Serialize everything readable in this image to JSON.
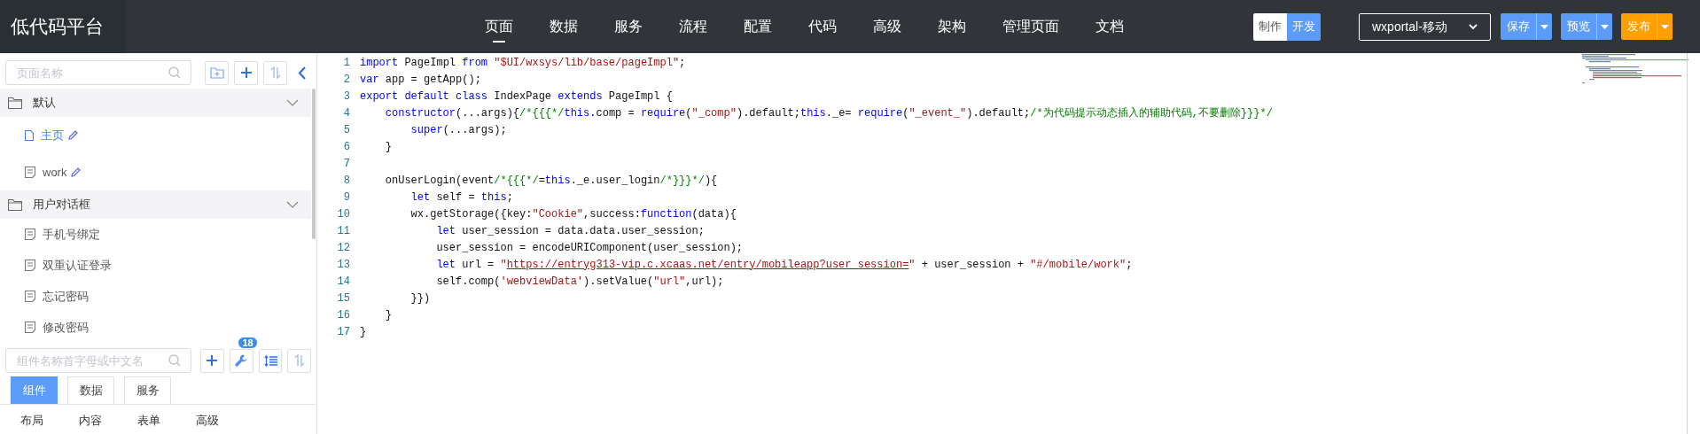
{
  "app_title": "低代码平台",
  "nav": [
    {
      "label": "页面",
      "selected": true
    },
    {
      "label": "数据",
      "selected": false
    },
    {
      "label": "服务",
      "selected": false
    },
    {
      "label": "流程",
      "selected": false
    },
    {
      "label": "配置",
      "selected": false
    },
    {
      "label": "代码",
      "selected": false
    },
    {
      "label": "高级",
      "selected": false
    },
    {
      "label": "架构",
      "selected": false
    },
    {
      "label": "管理页面",
      "selected": false
    },
    {
      "label": "文档",
      "selected": false
    }
  ],
  "mode_toggle": [
    {
      "label": "制作",
      "selected": false
    },
    {
      "label": "开发",
      "selected": true
    }
  ],
  "app_select": {
    "value": "wxportal-移动"
  },
  "actions": [
    {
      "label": "保存",
      "color": "#5b9cf8"
    },
    {
      "label": "预览",
      "color": "#5b9cf8"
    },
    {
      "label": "发布",
      "color": "#ffa000"
    }
  ],
  "page_search": {
    "placeholder": "页面名称"
  },
  "page_tree": [
    {
      "label": "默认",
      "expanded": true,
      "children": [
        {
          "label": "主页",
          "selected": true,
          "editable": true
        },
        {
          "label": "work",
          "selected": false,
          "editable": true
        }
      ]
    },
    {
      "label": "用户对话框",
      "expanded": true,
      "children": [
        {
          "label": "手机号绑定",
          "selected": false,
          "editable": false
        },
        {
          "label": "双重认证登录",
          "selected": false,
          "editable": false
        },
        {
          "label": "忘记密码",
          "selected": false,
          "editable": false
        },
        {
          "label": "修改密码",
          "selected": false,
          "editable": false
        }
      ]
    }
  ],
  "component_search": {
    "placeholder": "组件名称首字母或中文名"
  },
  "tool_badge": "18",
  "panel_tabs": [
    {
      "label": "组件",
      "selected": true
    },
    {
      "label": "数据",
      "selected": false
    },
    {
      "label": "服务",
      "selected": false
    }
  ],
  "categories": [
    "布局",
    "内容",
    "表单",
    "高级"
  ],
  "editor": {
    "lines": [
      {
        "number": "1",
        "tokens": [
          {
            "kind": "keyword",
            "text": "import"
          },
          {
            "kind": "plain",
            "text": " PageImpl "
          },
          {
            "kind": "keyword",
            "text": "from"
          },
          {
            "kind": "string",
            "text": " \"$UI/wxsys/lib/base/pageImpl\""
          },
          {
            "kind": "plain",
            "text": ";"
          }
        ]
      },
      {
        "number": "2",
        "tokens": [
          {
            "kind": "keyword",
            "text": "var"
          },
          {
            "kind": "plain",
            "text": " app = getApp();"
          }
        ]
      },
      {
        "number": "3",
        "tokens": [
          {
            "kind": "keyword",
            "text": "export default class"
          },
          {
            "kind": "plain",
            "text": " IndexPage "
          },
          {
            "kind": "keyword",
            "text": "extends"
          },
          {
            "kind": "plain",
            "text": " PageImpl {"
          }
        ]
      },
      {
        "number": "4",
        "tokens": [
          {
            "kind": "keyword",
            "text": "    constructor"
          },
          {
            "kind": "plain",
            "text": "(...args){"
          },
          {
            "kind": "comment",
            "text": "/*{{{*/"
          },
          {
            "kind": "keyword",
            "text": "this"
          },
          {
            "kind": "plain",
            "text": ".comp = "
          },
          {
            "kind": "keyword",
            "text": "require"
          },
          {
            "kind": "plain",
            "text": "("
          },
          {
            "kind": "string",
            "text": "\"_comp\""
          },
          {
            "kind": "plain",
            "text": ").default;"
          },
          {
            "kind": "keyword",
            "text": "this"
          },
          {
            "kind": "plain",
            "text": "._e= "
          },
          {
            "kind": "keyword",
            "text": "require"
          },
          {
            "kind": "plain",
            "text": "("
          },
          {
            "kind": "string",
            "text": "\"_event_\""
          },
          {
            "kind": "plain",
            "text": ").default;"
          },
          {
            "kind": "comment",
            "text": "/*为代码提示动态插入的辅助代码,不要删除}}}*/"
          }
        ]
      },
      {
        "number": "5",
        "tokens": [
          {
            "kind": "keyword",
            "text": "        super"
          },
          {
            "kind": "plain",
            "text": "(...args);"
          }
        ]
      },
      {
        "number": "6",
        "tokens": [
          {
            "kind": "plain",
            "text": "    }"
          }
        ]
      },
      {
        "number": "7"
      },
      {
        "number": "8",
        "tokens": [
          {
            "kind": "plain",
            "text": "    onUserLogin(event"
          },
          {
            "kind": "comment",
            "text": "/*{{{*/"
          },
          {
            "kind": "plain",
            "text": "="
          },
          {
            "kind": "keyword",
            "text": "this"
          },
          {
            "kind": "plain",
            "text": "._e.user_login"
          },
          {
            "kind": "comment",
            "text": "/*}}}*/"
          },
          {
            "kind": "plain",
            "text": "){"
          }
        ]
      },
      {
        "number": "9",
        "tokens": [
          {
            "kind": "keyword",
            "text": "        let"
          },
          {
            "kind": "plain",
            "text": " self = "
          },
          {
            "kind": "keyword",
            "text": "this"
          },
          {
            "kind": "plain",
            "text": ";"
          }
        ]
      },
      {
        "number": "10",
        "tokens": [
          {
            "kind": "plain",
            "text": "        wx.getStorage({key:"
          },
          {
            "kind": "string",
            "text": "\"Cookie\""
          },
          {
            "kind": "plain",
            "text": ",success:"
          },
          {
            "kind": "keyword",
            "text": "function"
          },
          {
            "kind": "plain",
            "text": "(data){"
          }
        ]
      },
      {
        "number": "11",
        "tokens": [
          {
            "kind": "keyword",
            "text": "            let"
          },
          {
            "kind": "plain",
            "text": " user_session = data.data.user_session;"
          }
        ]
      },
      {
        "number": "12",
        "tokens": [
          {
            "kind": "plain",
            "text": "            user_session = encodeURIComponent(user_session);"
          }
        ]
      },
      {
        "number": "13",
        "tokens": [
          {
            "kind": "keyword",
            "text": "            let"
          },
          {
            "kind": "plain",
            "text": " url = "
          },
          {
            "kind": "string",
            "text": "\""
          },
          {
            "kind": "url",
            "text": "https://entryg313-vip.c.xcaas.net/entry/mobileapp?user_session="
          },
          {
            "kind": "string",
            "text": "\""
          },
          {
            "kind": "plain",
            "text": " + user_session + "
          },
          {
            "kind": "string",
            "text": "\"#/mobile/work\""
          },
          {
            "kind": "plain",
            "text": ";"
          }
        ]
      },
      {
        "number": "14",
        "tokens": [
          {
            "kind": "plain",
            "text": "            self.comp("
          },
          {
            "kind": "string",
            "text": "'webviewData'"
          },
          {
            "kind": "plain",
            "text": ").setValue("
          },
          {
            "kind": "string",
            "text": "\"url\""
          },
          {
            "kind": "plain",
            "text": ",url);"
          }
        ]
      },
      {
        "number": "15",
        "tokens": [
          {
            "kind": "plain",
            "text": "        }})"
          }
        ]
      },
      {
        "number": "16",
        "tokens": [
          {
            "kind": "plain",
            "text": "    }"
          }
        ]
      },
      {
        "number": "17",
        "tokens": [
          {
            "kind": "plain",
            "text": "}"
          }
        ]
      }
    ]
  }
}
